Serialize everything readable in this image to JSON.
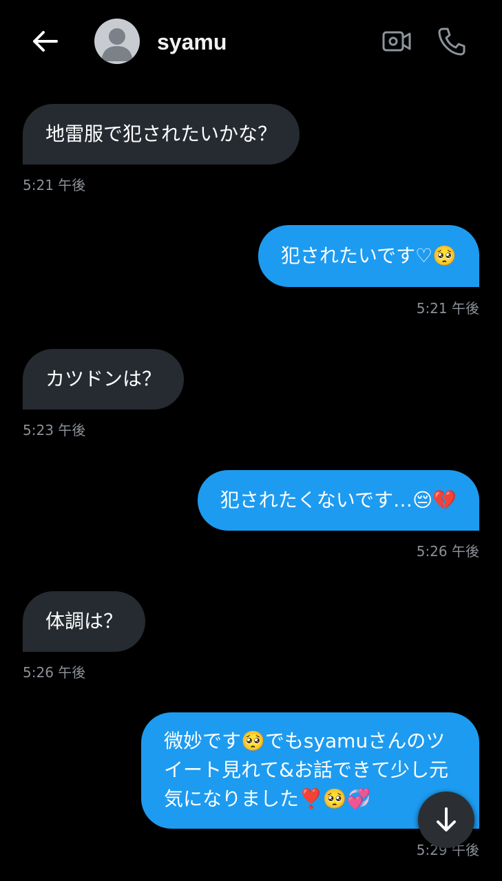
{
  "header": {
    "contact_name": "syamu"
  },
  "icons": {
    "back": "arrow-left-icon",
    "avatar": "default-user-icon",
    "video": "video-camera-icon",
    "phone": "phone-icon",
    "scroll": "arrow-down-icon"
  },
  "colors": {
    "incoming_bubble": "#262b31",
    "outgoing_bubble": "#1d9bf0",
    "timestamp": "#8b9199",
    "background": "#000000"
  },
  "messages": [
    {
      "direction": "incoming",
      "text": "地雷服で犯されたいかな？",
      "time": "5:21 午後"
    },
    {
      "direction": "outgoing",
      "text": "犯されたいです♡🥺",
      "time": "5:21 午後"
    },
    {
      "direction": "incoming",
      "text": "カツドンは？",
      "time": "5:23 午後"
    },
    {
      "direction": "outgoing",
      "text": "犯されたくないです…😔💔",
      "time": "5:26 午後"
    },
    {
      "direction": "incoming",
      "text": "体調は？",
      "time": "5:26 午後"
    },
    {
      "direction": "outgoing",
      "text": "微妙です🥺でもsyamuさんのツイート見れて&お話できて少し元気になりました❣️🥺💞",
      "time": "5:29 午後"
    }
  ]
}
